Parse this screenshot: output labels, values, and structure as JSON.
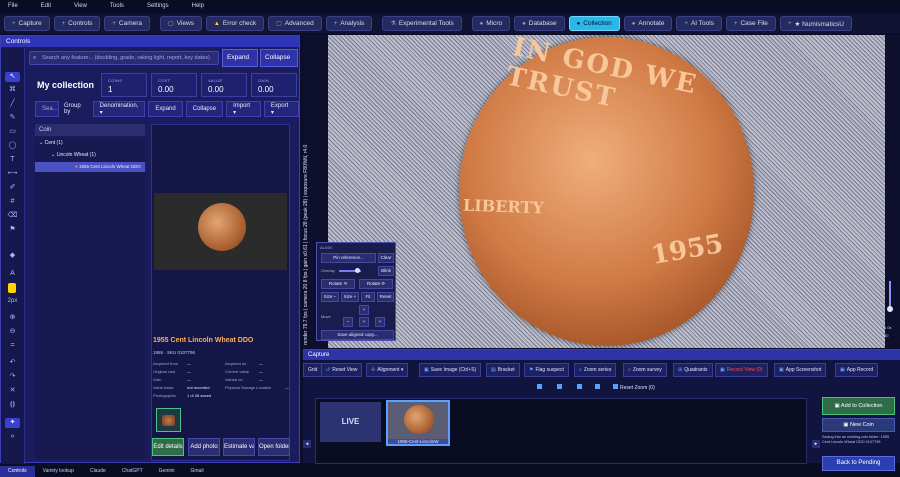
{
  "menu": [
    "File",
    "Edit",
    "View",
    "Tools",
    "Settings",
    "Help"
  ],
  "tabs": [
    {
      "label": "Capture",
      "icon": "plus-icon"
    },
    {
      "label": "Controls",
      "icon": "plus-icon"
    },
    {
      "label": "Camera",
      "icon": "plus-icon"
    },
    {
      "label": "Views",
      "icon": "square-icon"
    },
    {
      "label": "Error check",
      "icon": "warning-icon"
    },
    {
      "label": "Advanced",
      "icon": "square-icon"
    },
    {
      "label": "Analysis",
      "icon": "plus-icon"
    },
    {
      "label": "Experimental Tools",
      "icon": "flask-icon"
    },
    {
      "label": "Micro",
      "icon": "circle-icon"
    },
    {
      "label": "Database",
      "icon": "circle-icon"
    },
    {
      "label": "Collection",
      "icon": "circle-icon",
      "active": true
    },
    {
      "label": "Annotate",
      "icon": "circle-icon"
    },
    {
      "label": "AI Tools",
      "icon": "plus-icon"
    },
    {
      "label": "Case File",
      "icon": "plus-icon"
    },
    {
      "label": "★ NumismaticsU",
      "icon": "plus-icon"
    }
  ],
  "controls": {
    "title": "Controls",
    "search_placeholder": "Search any feature... (doubling, grade, raking light, report, key dates)",
    "expand_all": "Expand all",
    "collapse_all": "Collapse all",
    "collection_title": "My collection",
    "stats": [
      {
        "label": "COINS",
        "value": "1"
      },
      {
        "label": "COST",
        "value": "0.00"
      },
      {
        "label": "VALUE",
        "value": "0.00"
      },
      {
        "label": "GAIN",
        "value": "0.00"
      }
    ],
    "search_small": "Sea...",
    "group_by_label": "Group by",
    "group_by_value": "Denomination, ▾",
    "expand": "Expand",
    "collapse": "Collapse",
    "import": "Import ▾",
    "export": "Export ▾",
    "tree_header": "Coin",
    "tree": [
      {
        "label": "Cent  (1)"
      },
      {
        "label": "Lincoln Wheat  (1)"
      },
      {
        "label": "1955 Cent Lincoln Wheat DDO"
      }
    ],
    "detail": {
      "title": "1955 Cent Lincoln Wheat DDO",
      "subtitle": "1955  ·  SKU 0107796",
      "fields": [
        {
          "k": "Acquired from",
          "v": "—",
          "k2": "Acquired on",
          "v2": "—"
        },
        {
          "k": "Original cost",
          "v": "—",
          "k2": "Current value",
          "v2": "—"
        },
        {
          "k": "Gain",
          "v": "—",
          "k2": "Valued on",
          "v2": "—"
        },
        {
          "k": "Value basis",
          "v": "not recorded",
          "k2": "Physical Storage Location",
          "v2": "—"
        },
        {
          "k": "Photographs",
          "v": "1 of 28 saved",
          "k2": "",
          "v2": ""
        }
      ],
      "buttons": [
        "Edit details",
        "Add photo",
        "Estimate value",
        "Open folder"
      ]
    }
  },
  "bottom_tabs": [
    "Controls",
    "Variety lookup",
    "Claude",
    "ChatGPT",
    "Gemini",
    "Gmail"
  ],
  "viewport": {
    "overlay": "render 79.7 fps | camera 20.8 fps | gain x0.61 | focus 28 (peak 28) | exposure F80%N, r4.0",
    "coin_texts": {
      "top": "IN GOD WE TRUST",
      "liberty": "LIBERTY",
      "year": "1955"
    },
    "zoom_labels": [
      "1.0x",
      "30"
    ]
  },
  "align": {
    "head": "ALIGN",
    "pin": "Pin reference...",
    "clear": "Clear",
    "overlay": "Overlay",
    "blink": "Blink",
    "rotate_ccw": "Rotate ⟲",
    "rotate_cw": "Rotate ⟳",
    "size_minus": "Size −",
    "size_plus": "Size +",
    "fit": "Fit",
    "reset": "Reset",
    "move": "Move",
    "save": "Save aligned copy..."
  },
  "capture": {
    "title": "Capture",
    "toolbar": [
      {
        "label": "Grid"
      },
      {
        "label": "Reset View"
      },
      {
        "label": "Alignment ▾"
      },
      {
        "label": "Save Image  (Ctrl+S)"
      },
      {
        "label": "Bracket"
      },
      {
        "label": "Flag suspect"
      },
      {
        "label": "Zoom series"
      },
      {
        "label": "Zoom survey"
      },
      {
        "label": "Quadrants"
      },
      {
        "label": "Record View"
      },
      {
        "label": "App Screenshot"
      },
      {
        "label": "App Record"
      }
    ],
    "record_view_count": "(0)",
    "reset_zoom": "Reset Zoom  (0)",
    "live": "LIVE",
    "thumb_label": "1955-Cent-LincolnW",
    "add_to_collection": "Add to Collection",
    "new_coin": "New Coin",
    "saving_info": "Saving into an existing coin folder: 1955 Cent Lincoln Wheat DDO 0107796",
    "back_to_pending": "Back to Pending"
  },
  "colors": {
    "accent": "#29b8e8",
    "panel": "#1a1c5e",
    "orange_title": "#ffb04a",
    "green": "#2e6d48"
  }
}
